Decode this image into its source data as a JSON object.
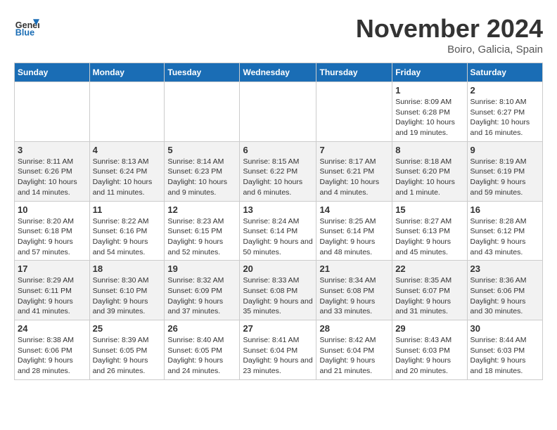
{
  "header": {
    "logo_general": "General",
    "logo_blue": "Blue",
    "month_title": "November 2024",
    "location": "Boiro, Galicia, Spain"
  },
  "weekdays": [
    "Sunday",
    "Monday",
    "Tuesday",
    "Wednesday",
    "Thursday",
    "Friday",
    "Saturday"
  ],
  "weeks": [
    [
      {
        "day": "",
        "info": ""
      },
      {
        "day": "",
        "info": ""
      },
      {
        "day": "",
        "info": ""
      },
      {
        "day": "",
        "info": ""
      },
      {
        "day": "",
        "info": ""
      },
      {
        "day": "1",
        "info": "Sunrise: 8:09 AM\nSunset: 6:28 PM\nDaylight: 10 hours and 19 minutes."
      },
      {
        "day": "2",
        "info": "Sunrise: 8:10 AM\nSunset: 6:27 PM\nDaylight: 10 hours and 16 minutes."
      }
    ],
    [
      {
        "day": "3",
        "info": "Sunrise: 8:11 AM\nSunset: 6:26 PM\nDaylight: 10 hours and 14 minutes."
      },
      {
        "day": "4",
        "info": "Sunrise: 8:13 AM\nSunset: 6:24 PM\nDaylight: 10 hours and 11 minutes."
      },
      {
        "day": "5",
        "info": "Sunrise: 8:14 AM\nSunset: 6:23 PM\nDaylight: 10 hours and 9 minutes."
      },
      {
        "day": "6",
        "info": "Sunrise: 8:15 AM\nSunset: 6:22 PM\nDaylight: 10 hours and 6 minutes."
      },
      {
        "day": "7",
        "info": "Sunrise: 8:17 AM\nSunset: 6:21 PM\nDaylight: 10 hours and 4 minutes."
      },
      {
        "day": "8",
        "info": "Sunrise: 8:18 AM\nSunset: 6:20 PM\nDaylight: 10 hours and 1 minute."
      },
      {
        "day": "9",
        "info": "Sunrise: 8:19 AM\nSunset: 6:19 PM\nDaylight: 9 hours and 59 minutes."
      }
    ],
    [
      {
        "day": "10",
        "info": "Sunrise: 8:20 AM\nSunset: 6:18 PM\nDaylight: 9 hours and 57 minutes."
      },
      {
        "day": "11",
        "info": "Sunrise: 8:22 AM\nSunset: 6:16 PM\nDaylight: 9 hours and 54 minutes."
      },
      {
        "day": "12",
        "info": "Sunrise: 8:23 AM\nSunset: 6:15 PM\nDaylight: 9 hours and 52 minutes."
      },
      {
        "day": "13",
        "info": "Sunrise: 8:24 AM\nSunset: 6:14 PM\nDaylight: 9 hours and 50 minutes."
      },
      {
        "day": "14",
        "info": "Sunrise: 8:25 AM\nSunset: 6:14 PM\nDaylight: 9 hours and 48 minutes."
      },
      {
        "day": "15",
        "info": "Sunrise: 8:27 AM\nSunset: 6:13 PM\nDaylight: 9 hours and 45 minutes."
      },
      {
        "day": "16",
        "info": "Sunrise: 8:28 AM\nSunset: 6:12 PM\nDaylight: 9 hours and 43 minutes."
      }
    ],
    [
      {
        "day": "17",
        "info": "Sunrise: 8:29 AM\nSunset: 6:11 PM\nDaylight: 9 hours and 41 minutes."
      },
      {
        "day": "18",
        "info": "Sunrise: 8:30 AM\nSunset: 6:10 PM\nDaylight: 9 hours and 39 minutes."
      },
      {
        "day": "19",
        "info": "Sunrise: 8:32 AM\nSunset: 6:09 PM\nDaylight: 9 hours and 37 minutes."
      },
      {
        "day": "20",
        "info": "Sunrise: 8:33 AM\nSunset: 6:08 PM\nDaylight: 9 hours and 35 minutes."
      },
      {
        "day": "21",
        "info": "Sunrise: 8:34 AM\nSunset: 6:08 PM\nDaylight: 9 hours and 33 minutes."
      },
      {
        "day": "22",
        "info": "Sunrise: 8:35 AM\nSunset: 6:07 PM\nDaylight: 9 hours and 31 minutes."
      },
      {
        "day": "23",
        "info": "Sunrise: 8:36 AM\nSunset: 6:06 PM\nDaylight: 9 hours and 30 minutes."
      }
    ],
    [
      {
        "day": "24",
        "info": "Sunrise: 8:38 AM\nSunset: 6:06 PM\nDaylight: 9 hours and 28 minutes."
      },
      {
        "day": "25",
        "info": "Sunrise: 8:39 AM\nSunset: 6:05 PM\nDaylight: 9 hours and 26 minutes."
      },
      {
        "day": "26",
        "info": "Sunrise: 8:40 AM\nSunset: 6:05 PM\nDaylight: 9 hours and 24 minutes."
      },
      {
        "day": "27",
        "info": "Sunrise: 8:41 AM\nSunset: 6:04 PM\nDaylight: 9 hours and 23 minutes."
      },
      {
        "day": "28",
        "info": "Sunrise: 8:42 AM\nSunset: 6:04 PM\nDaylight: 9 hours and 21 minutes."
      },
      {
        "day": "29",
        "info": "Sunrise: 8:43 AM\nSunset: 6:03 PM\nDaylight: 9 hours and 20 minutes."
      },
      {
        "day": "30",
        "info": "Sunrise: 8:44 AM\nSunset: 6:03 PM\nDaylight: 9 hours and 18 minutes."
      }
    ]
  ]
}
